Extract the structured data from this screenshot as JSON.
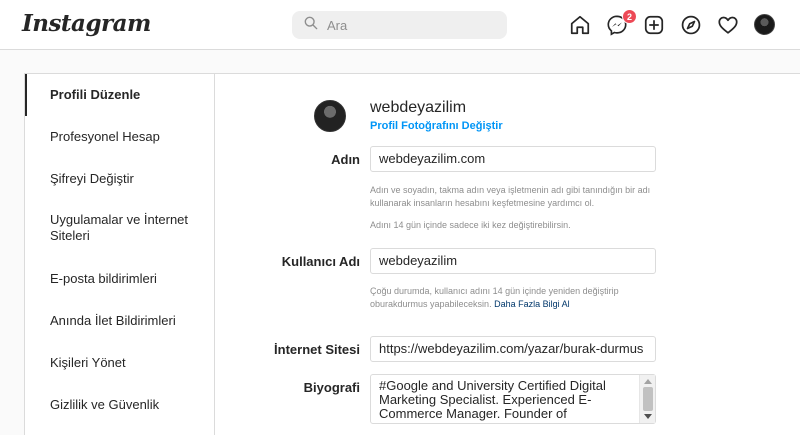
{
  "header": {
    "logo": "Instagram",
    "search_placeholder": "Ara",
    "messages_badge": "2"
  },
  "sidebar": {
    "items": [
      {
        "label": "Profili Düzenle",
        "active": true
      },
      {
        "label": "Profesyonel Hesap"
      },
      {
        "label": "Şifreyi Değiştir"
      },
      {
        "label": "Uygulamalar ve İnternet Siteleri"
      },
      {
        "label": "E-posta bildirimleri"
      },
      {
        "label": "Anında İlet Bildirimleri"
      },
      {
        "label": "Kişileri Yönet"
      },
      {
        "label": "Gizlilik ve Güvenlik"
      }
    ]
  },
  "profile": {
    "username": "webdeyazilim",
    "change_photo": "Profil Fotoğrafını Değiştir"
  },
  "form": {
    "name_label": "Adın",
    "name_value": "webdeyazilim.com",
    "name_help_1": "Adın ve soyadın, takma adın veya işletmenin adı gibi tanındığın bir adı kullanarak insanların hesabını keşfetmesine yardımcı ol.",
    "name_help_2": "Adını 14 gün içinde sadece iki kez değiştirebilirsin.",
    "username_label": "Kullanıcı Adı",
    "username_value": "webdeyazilim",
    "username_help": "Çoğu durumda, kullanıcı adını 14 gün içinde yeniden değiştirip oburakdurmus yapabileceksin.",
    "username_help_link": "Daha Fazla Bilgi Al",
    "website_label": "İnternet Sitesi",
    "website_value": "https://webdeyazilim.com/yazar/burak-durmus",
    "bio_label": "Biyografi",
    "bio_value": "#Google and University Certified Digital Marketing Specialist. Experienced E-Commerce Manager. Founder of"
  },
  "colors": {
    "accent": "#0095f6",
    "badge": "#ed4956",
    "border": "#dbdbdb",
    "muted": "#8e8e8e"
  },
  "icons": [
    "search-icon",
    "home-icon",
    "messenger-icon",
    "new-post-icon",
    "explore-icon",
    "heart-icon"
  ]
}
